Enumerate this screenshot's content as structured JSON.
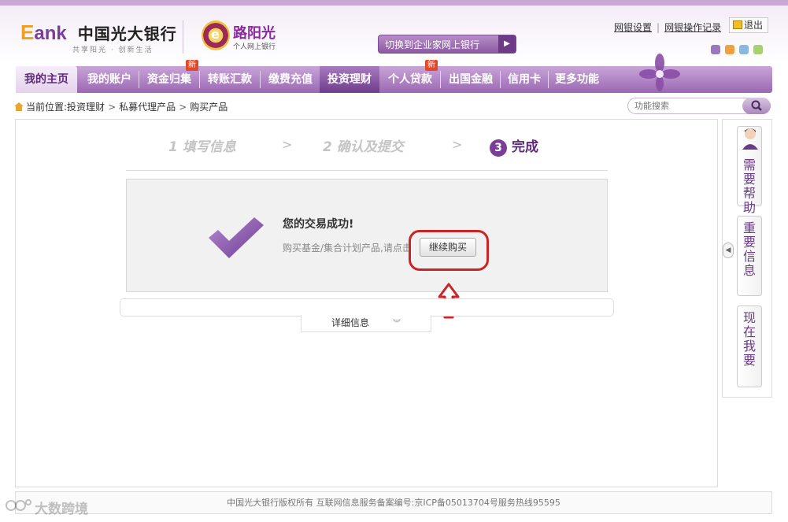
{
  "header": {
    "logo_e": "E",
    "logo_ank": "ank",
    "logo_cn": "中国光大银行",
    "slogan": "共享阳光 · 创新生活",
    "sub_brand": "路阳光",
    "sub_brand_caption": "个人网上银行",
    "switch_label": "切换到企业家网上银行",
    "links": [
      "网银设置",
      "网银操作记录"
    ],
    "logout": "退出",
    "swatches": [
      "#9a7ab8",
      "#f0a040",
      "#8ab6e0",
      "#a8d070"
    ]
  },
  "nav": {
    "items": [
      "我的主页",
      "我的账户",
      "资金归集",
      "转账汇款",
      "缴费充值",
      "投资理财",
      "个人贷款",
      "出国金融",
      "信用卡",
      "更多功能"
    ],
    "new_tag": "新",
    "active": "投资理财"
  },
  "breadcrumb": {
    "prefix": "当前位置:",
    "items": [
      "投资理财",
      "私募代理产品",
      "购买产品"
    ],
    "separator": ">"
  },
  "search": {
    "placeholder": "功能搜索"
  },
  "steps": [
    {
      "label": "1 填写信息"
    },
    {
      "label": "2 确认及提交"
    },
    {
      "num": "3",
      "label": "完成"
    }
  ],
  "step_arrow": ">",
  "result": {
    "title": "您的交易成功!",
    "desc": "购买基金/集合计划产品,请点击",
    "continue_button": "继续购买"
  },
  "detail": {
    "label": "详细信息",
    "chevron": "︾"
  },
  "sidebar": {
    "items": [
      {
        "label": "需要帮助"
      },
      {
        "label": "重要信息"
      },
      {
        "label": "现在我要"
      }
    ],
    "toggle": "◀"
  },
  "footer": {
    "text": "中国光大银行版权所有 互联网信息服务备案编号:京ICP备05013704号服务热线95595"
  },
  "watermark": {
    "text": "大数跨境"
  }
}
